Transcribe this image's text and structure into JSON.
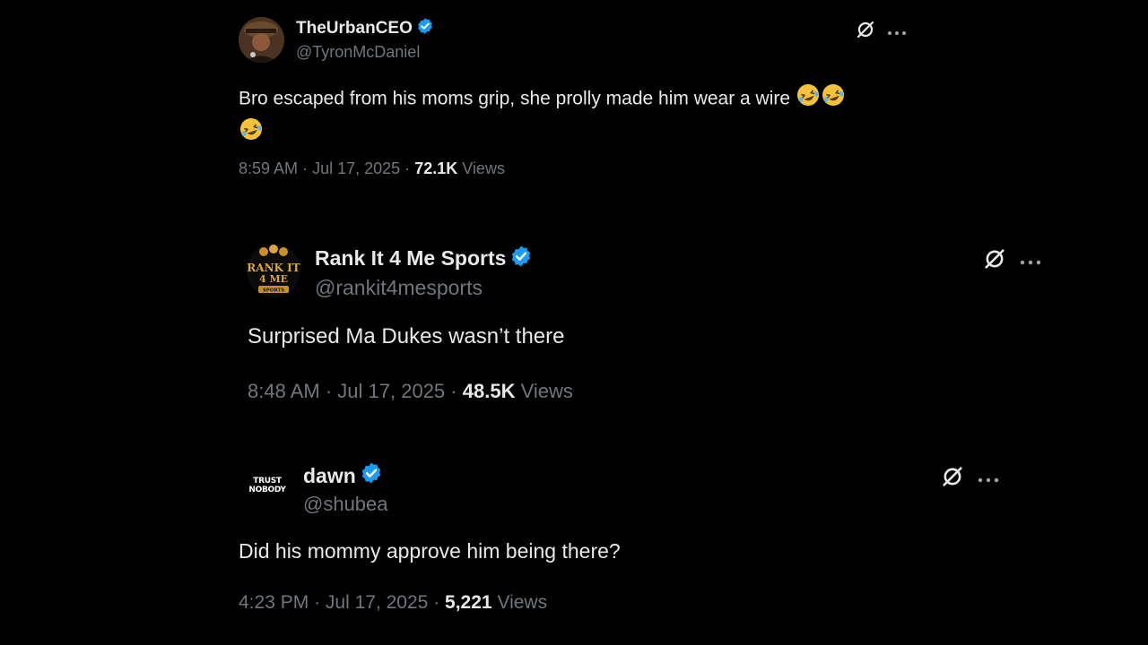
{
  "tweets": [
    {
      "display_name": "TheUrbanCEO",
      "handle": "@TyronMcDaniel",
      "verified": true,
      "text": "Bro escaped from his moms grip, she prolly made him wear a wire",
      "emojis": [
        "rolling-on-floor-laughing",
        "rolling-on-floor-laughing",
        "rolling-on-floor-laughing"
      ],
      "time": "8:59 AM",
      "date": "Jul 17, 2025",
      "views_count": "72.1K",
      "views_label": "Views"
    },
    {
      "display_name": "Rank It 4 Me Sports",
      "handle": "@rankit4mesports",
      "verified": true,
      "avatar_text": [
        "RANK IT",
        "4 ME",
        "SPORTS"
      ],
      "text": "Surprised Ma Dukes wasn’t there",
      "time": "8:48 AM",
      "date": "Jul 17, 2025",
      "views_count": "48.5K",
      "views_label": "Views"
    },
    {
      "display_name": "dawn",
      "handle": "@shubea",
      "verified": true,
      "avatar_text": [
        "TRUST",
        "NOBODY"
      ],
      "text": "Did his mommy approve him being there?",
      "time": "4:23 PM",
      "date": "Jul 17, 2025",
      "views_count": "5,221",
      "views_label": "Views"
    }
  ],
  "separator": "·",
  "icons": {
    "verified": "verified-badge-icon",
    "grok": "grok-icon",
    "more": "more-icon"
  },
  "colors": {
    "background": "#000000",
    "text_primary": "#e7e9ea",
    "text_secondary": "#71767b",
    "verified_blue": "#1d9bf0"
  }
}
